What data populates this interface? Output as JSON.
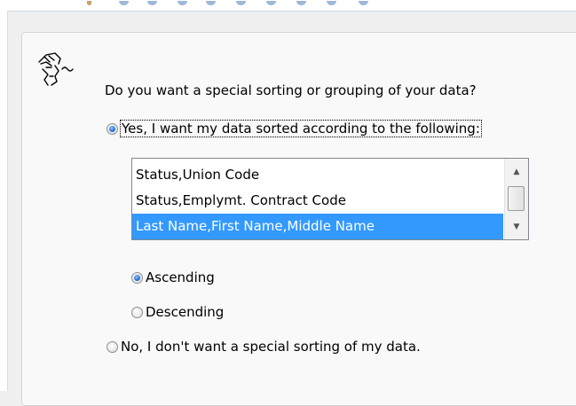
{
  "question": "Do you want a special sorting or grouping of your data?",
  "yes_option": {
    "label": "Yes, I want my data sorted according to the following:",
    "checked": true
  },
  "sort_list": {
    "items": [
      "Status,Union Code",
      "Status,Emplymt. Contract Code",
      "Last Name,First Name,Middle Name"
    ],
    "selected_index": 2
  },
  "ascending_option": {
    "label": "Ascending",
    "checked": true
  },
  "descending_option": {
    "label": "Descending",
    "checked": false
  },
  "no_option": {
    "label": "No, I don't want a special sorting of my data.",
    "checked": false
  },
  "icons": {
    "wizard": "wizard-face-icon",
    "scroll_up": "scroll-up-arrow-icon",
    "scroll_down": "scroll-down-arrow-icon"
  },
  "colors": {
    "selection": "#3399ff",
    "radio_dot": "#2a6fd1",
    "panel_bg": "#f9f9f9"
  }
}
